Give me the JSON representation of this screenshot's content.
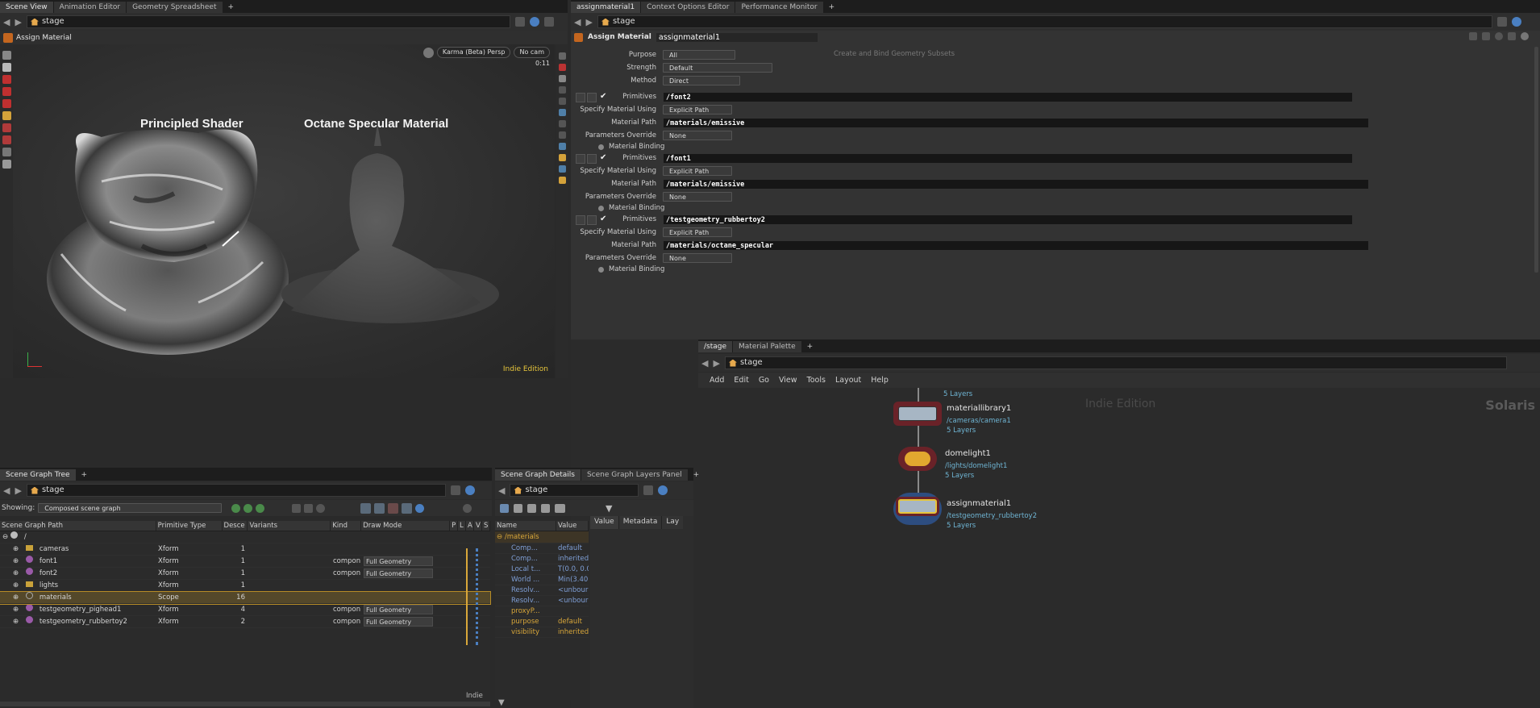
{
  "left_tabs": [
    "Scene View",
    "Animation Editor",
    "Geometry Spreadsheet"
  ],
  "right_tabs": [
    "assignmaterial1",
    "Context Options Editor",
    "Performance Monitor"
  ],
  "path_left": "stage",
  "path_right": "stage",
  "viewport": {
    "node_type": "Assign Material",
    "renderer": "Karma (Beta)  Persp",
    "camera": "No cam",
    "time": "0:11",
    "label_left": "Principled Shader",
    "label_right": "Octane Specular Material",
    "watermark": "Indie Edition"
  },
  "parm_header": {
    "type": "Assign Material",
    "name": "assignmaterial1",
    "faded": "Create and Bind Geometry Subsets"
  },
  "parms_top": [
    {
      "label": "Purpose",
      "value": "All"
    },
    {
      "label": "Strength",
      "value": "Default"
    },
    {
      "label": "Method",
      "value": "Direct"
    }
  ],
  "parm_blocks": [
    {
      "primitives": "/font2",
      "specify_label": "Specify Material Using",
      "specify": "Explicit Path",
      "path_label": "Material Path",
      "path": "/materials/emissive",
      "override_label": "Parameters Override",
      "override": "None",
      "binding": "Material Binding"
    },
    {
      "primitives": "/font1",
      "specify_label": "Specify Material Using",
      "specify": "Explicit Path",
      "path_label": "Material Path",
      "path": "/materials/emissive",
      "override_label": "Parameters Override",
      "override": "None",
      "binding": "Material Binding"
    },
    {
      "primitives": "/testgeometry_rubbertoy2",
      "specify_label": "Specify Material Using",
      "specify": "Explicit Path",
      "path_label": "Material Path",
      "path": "/materials/octane_specular",
      "override_label": "Parameters Override",
      "override": "None",
      "binding": "Material Binding"
    }
  ],
  "primitives_label": "Primitives",
  "network": {
    "tabs": [
      "/stage",
      "Material Palette"
    ],
    "path": "stage",
    "menu": [
      "Add",
      "Edit",
      "Go",
      "View",
      "Tools",
      "Layout",
      "Help"
    ],
    "watermark": "Indie Edition",
    "context": "Solaris",
    "top_layers": "5 Layers",
    "nodes": [
      {
        "name": "materiallibrary1",
        "sub": "/cameras/camera1",
        "layers": "5 Layers"
      },
      {
        "name": "domelight1",
        "sub": "/lights/domelight1",
        "layers": "5 Layers"
      },
      {
        "name": "assignmaterial1",
        "sub": "/testgeometry_rubbertoy2",
        "layers": "5 Layers"
      }
    ]
  },
  "scene_tree": {
    "tabs": [
      "Scene Graph Tree"
    ],
    "path": "stage",
    "showing_label": "Showing:",
    "showing": "Composed scene graph",
    "headers": [
      "Scene Graph Path",
      "Primitive Type",
      "Desce",
      "Variants",
      "Kind",
      "Draw Mode",
      "P",
      "L",
      "A",
      "V",
      "S"
    ],
    "rows": [
      {
        "name": "/",
        "type": "",
        "desc": "",
        "kind": "",
        "draw": ""
      },
      {
        "name": "cameras",
        "type": "Xform",
        "desc": "1",
        "kind": "",
        "draw": ""
      },
      {
        "name": "font1",
        "type": "Xform",
        "desc": "1",
        "kind": "compon",
        "draw": "Full Geometry"
      },
      {
        "name": "font2",
        "type": "Xform",
        "desc": "1",
        "kind": "compon",
        "draw": "Full Geometry"
      },
      {
        "name": "lights",
        "type": "Xform",
        "desc": "1",
        "kind": "",
        "draw": ""
      },
      {
        "name": "materials",
        "type": "Scope",
        "desc": "16",
        "kind": "",
        "draw": ""
      },
      {
        "name": "testgeometry_pighead1",
        "type": "Xform",
        "desc": "4",
        "kind": "compon",
        "draw": "Full Geometry"
      },
      {
        "name": "testgeometry_rubbertoy2",
        "type": "Xform",
        "desc": "2",
        "kind": "compon",
        "draw": "Full Geometry"
      }
    ],
    "footer": "Indie"
  },
  "details": {
    "tabs": [
      "Scene Graph Details",
      "Scene Graph Layers Panel"
    ],
    "path": "stage",
    "headers": [
      "Name",
      "Value"
    ],
    "root": "/materials",
    "rows": [
      {
        "name": "Comp...",
        "value": "default"
      },
      {
        "name": "Comp...",
        "value": "inherited"
      },
      {
        "name": "Local t...",
        "value": "T(0.0, 0.0"
      },
      {
        "name": "World ...",
        "value": "Min(3.40"
      },
      {
        "name": "Resolv...",
        "value": "<unbour"
      },
      {
        "name": "Resolv...",
        "value": "<unbour"
      },
      {
        "name": "proxyP...",
        "value": ""
      },
      {
        "name": "purpose",
        "value": "default"
      },
      {
        "name": "visibility",
        "value": "inherited"
      }
    ],
    "right_tabs": [
      "Value",
      "Metadata",
      "Lay"
    ]
  }
}
